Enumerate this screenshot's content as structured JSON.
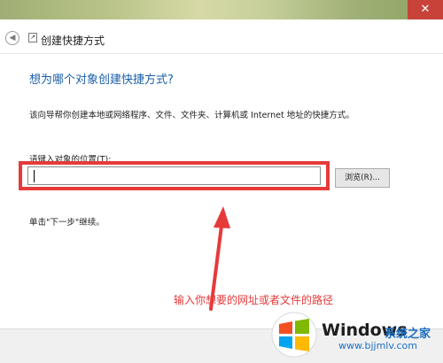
{
  "window": {
    "close_glyph": "✕"
  },
  "header": {
    "back_glyph": "◀",
    "title": "创建快捷方式"
  },
  "content": {
    "heading": "想为哪个对象创建快捷方式?",
    "description": "该向导帮你创建本地或网络程序、文件、文件夹、计算机或 Internet 地址的快捷方式。",
    "location_label": "请键入对象的位置(T):",
    "location_value": "",
    "browse_label": "浏览(R)...",
    "continue_hint": "单击\"下一步\"继续。"
  },
  "annotation": {
    "text": "输入你想要的网址或者文件的路径",
    "color": "#e63a3a"
  },
  "watermark": {
    "brand": "Windows",
    "subtitle": "系统之家",
    "url": "www.bjjmlv.com"
  },
  "colors": {
    "heading_blue": "#1b5fa8",
    "close_red": "#c7433a",
    "highlight_red": "#e63a3a"
  }
}
